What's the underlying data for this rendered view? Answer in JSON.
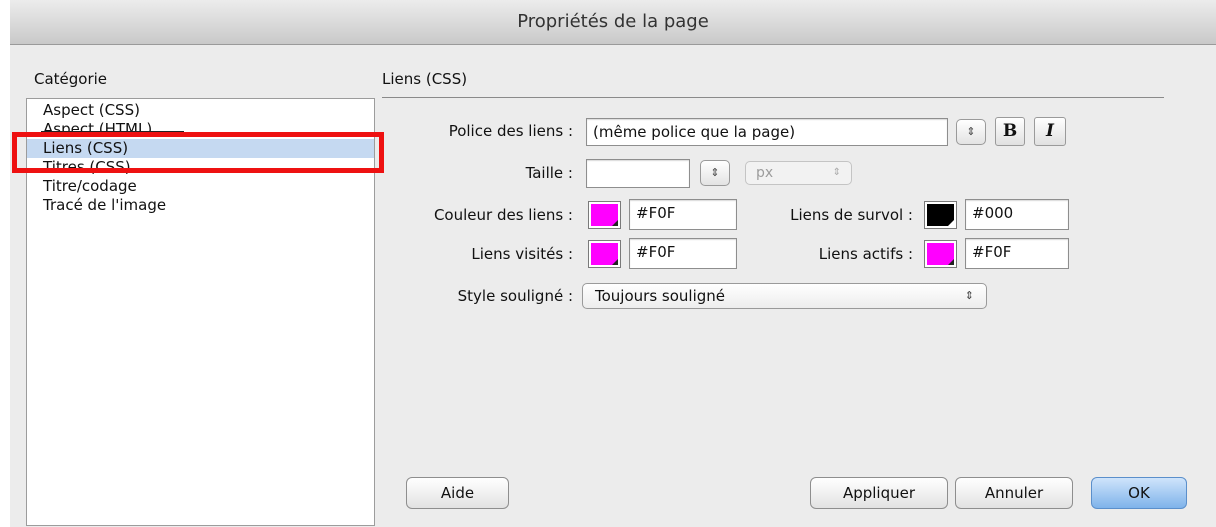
{
  "window": {
    "title": "Propriétés de la page"
  },
  "sidebar": {
    "label": "Catégorie",
    "items": [
      {
        "label": "Aspect (CSS)"
      },
      {
        "label": "Aspect (HTML)"
      },
      {
        "label": "Liens (CSS)"
      },
      {
        "label": "Titres (CSS)"
      },
      {
        "label": "Titre/codage"
      },
      {
        "label": "Tracé de l'image"
      }
    ],
    "selected": "Liens (CSS)"
  },
  "section": {
    "title": "Liens (CSS)"
  },
  "form": {
    "font": {
      "label": "Police des liens :",
      "value": "(même police que la page)",
      "bold_label": "B",
      "italic_label": "I"
    },
    "size": {
      "label": "Taille :",
      "value": "",
      "unit": "px"
    },
    "link_color": {
      "label": "Couleur des liens :",
      "value": "#F0F",
      "swatch": "#ff00ff"
    },
    "hover_color": {
      "label": "Liens de survol :",
      "value": "#000",
      "swatch": "#000000"
    },
    "visited_color": {
      "label": "Liens visités :",
      "value": "#F0F",
      "swatch": "#ff00ff"
    },
    "active_color": {
      "label": "Liens actifs :",
      "value": "#F0F",
      "swatch": "#ff00ff"
    },
    "underline": {
      "label": "Style souligné :",
      "value": "Toujours souligné"
    }
  },
  "buttons": {
    "help": "Aide",
    "apply": "Appliquer",
    "cancel": "Annuler",
    "ok": "OK"
  },
  "colors": {
    "highlight": "#ee1111",
    "selection": "#c5d9f1",
    "default_button": "#7fb3ea"
  }
}
